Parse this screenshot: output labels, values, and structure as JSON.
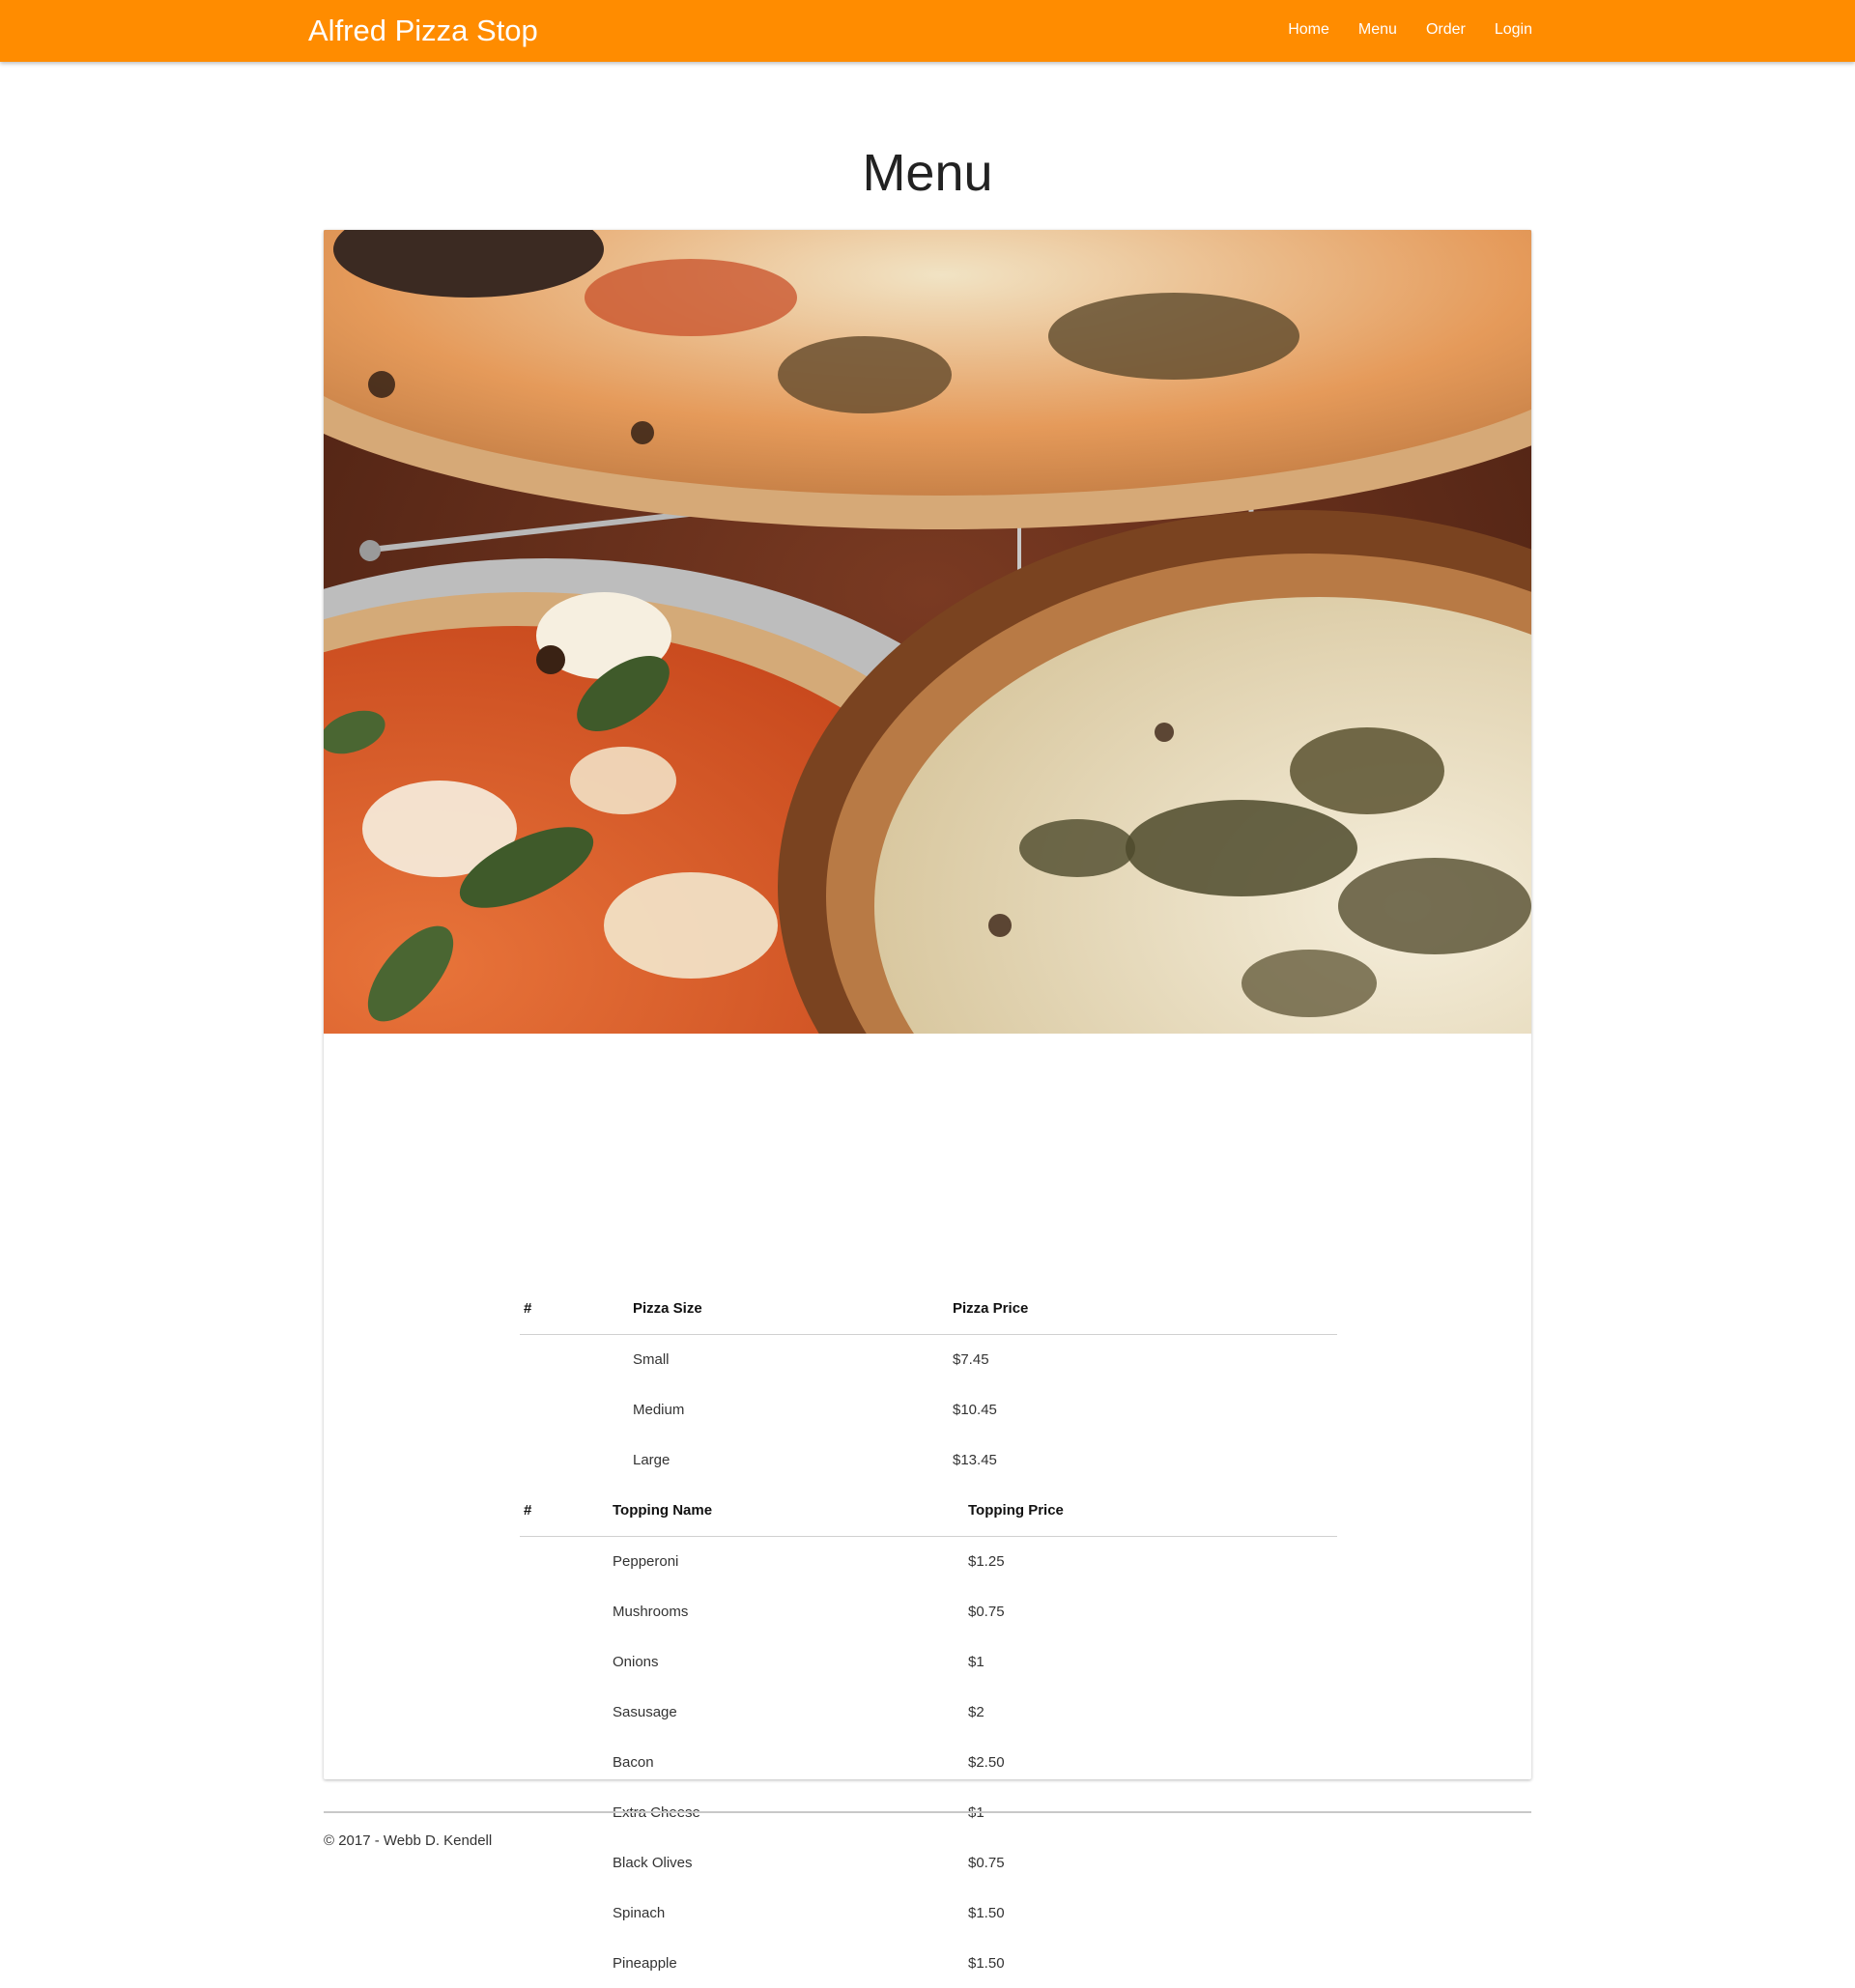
{
  "brand": "Alfred Pizza Stop",
  "nav": {
    "items": [
      "Home",
      "Menu",
      "Order",
      "Login"
    ]
  },
  "page_title": "Menu",
  "colors": {
    "navbar": "#ff8c00",
    "nav_text": "#ffffff"
  },
  "hero_image": "photo of margherita and mushroom pizzas",
  "size_table": {
    "headers": [
      "#",
      "Pizza Size",
      "Pizza Price"
    ],
    "rows": [
      {
        "num": "",
        "size": "Small",
        "price": "$7.45"
      },
      {
        "num": "",
        "size": "Medium",
        "price": "$10.45"
      },
      {
        "num": "",
        "size": "Large",
        "price": "$13.45"
      }
    ]
  },
  "topping_table": {
    "headers": [
      "#",
      "Topping Name",
      "Topping Price"
    ],
    "rows": [
      {
        "num": "",
        "name": "Pepperoni",
        "price": "$1.25"
      },
      {
        "num": "",
        "name": "Mushrooms",
        "price": "$0.75"
      },
      {
        "num": "",
        "name": "Onions",
        "price": "$1"
      },
      {
        "num": "",
        "name": "Sasusage",
        "price": "$2"
      },
      {
        "num": "",
        "name": "Bacon",
        "price": "$2.50"
      },
      {
        "num": "",
        "name": "Extra Cheese",
        "price": "$1"
      },
      {
        "num": "",
        "name": "Black Olives",
        "price": "$0.75"
      },
      {
        "num": "",
        "name": "Spinach",
        "price": "$1.50"
      },
      {
        "num": "",
        "name": "Pineapple",
        "price": "$1.50"
      }
    ]
  },
  "footer": "© 2017 - Webb D. Kendell"
}
